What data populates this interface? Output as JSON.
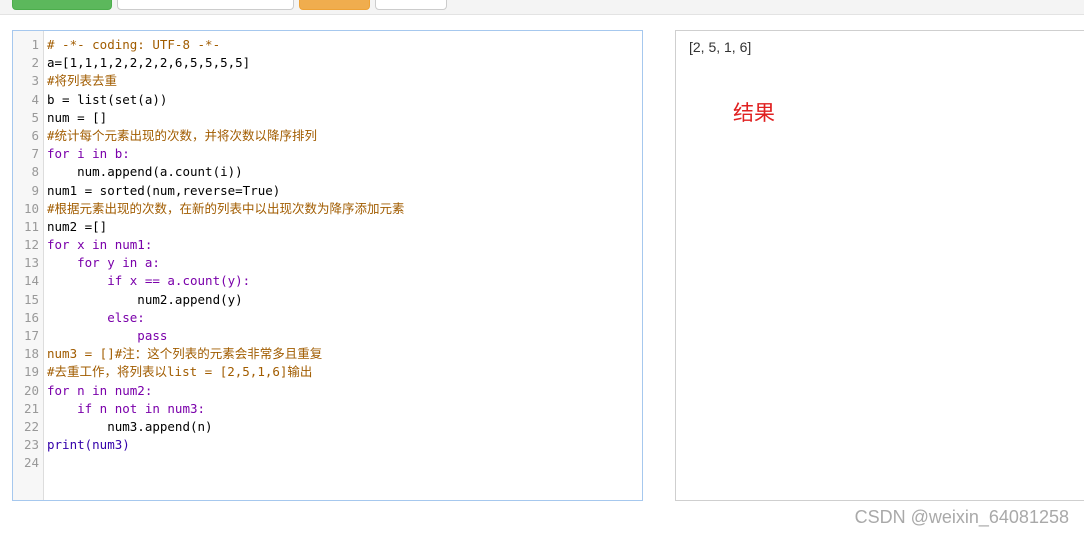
{
  "editor": {
    "line_numbers": [
      "1",
      "2",
      "3",
      "4",
      "5",
      "6",
      "7",
      "8",
      "9",
      "10",
      "11",
      "12",
      "13",
      "14",
      "15",
      "16",
      "17",
      "18",
      "19",
      "20",
      "21",
      "22",
      "23",
      "24"
    ],
    "lines": [
      "# -*- coding: UTF-8 -*-",
      "a=[1,1,1,2,2,2,2,6,5,5,5,5]",
      "#将列表去重",
      "b = list(set(a))",
      "num = []",
      "#统计每个元素出现的次数，并将次数以降序排列",
      "for i in b:",
      "    num.append(a.count(i))",
      "num1 = sorted(num,reverse=True)",
      "#根据元素出现的次数，在新的列表中以出现次数为降序添加元素",
      "num2 =[]",
      "for x in num1:",
      "    for y in a:",
      "        if x == a.count(y):",
      "            num2.append(y)",
      "        else:",
      "            pass",
      "num3 = []#注：这个列表的元素会非常多且重复",
      "#去重工作，将列表以list = [2,5,1,6]输出",
      "for n in num2:",
      "    if n not in num3:",
      "        num3.append(n)",
      "print(num3)",
      ""
    ]
  },
  "output": {
    "text": "[2, 5, 1, 6]",
    "annotation": "结果",
    "annotation_color": "#e02020"
  },
  "watermark": "CSDN @weixin_64081258"
}
